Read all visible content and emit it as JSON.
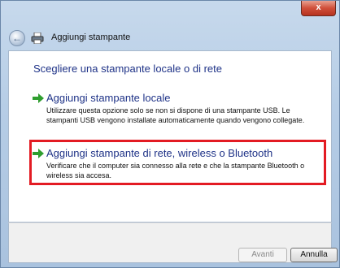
{
  "window": {
    "title": "Aggiungi stampante",
    "close_glyph": "x"
  },
  "content": {
    "heading": "Scegliere una stampante locale o di rete",
    "options": [
      {
        "title": "Aggiungi stampante locale",
        "description": "Utilizzare questa opzione solo se non si dispone di una stampante USB. Le stampanti USB vengono installate automaticamente quando vengono collegate.",
        "icon": "green-arrow-icon"
      },
      {
        "title": "Aggiungi stampante di rete, wireless o Bluetooth",
        "description": "Verificare che il computer sia connesso alla rete e che la stampante Bluetooth o wireless sia accesa.",
        "icon": "green-arrow-icon",
        "highlight_color": "#e31b23"
      }
    ]
  },
  "footer": {
    "next_label": "Avanti",
    "cancel_label": "Annulla"
  }
}
